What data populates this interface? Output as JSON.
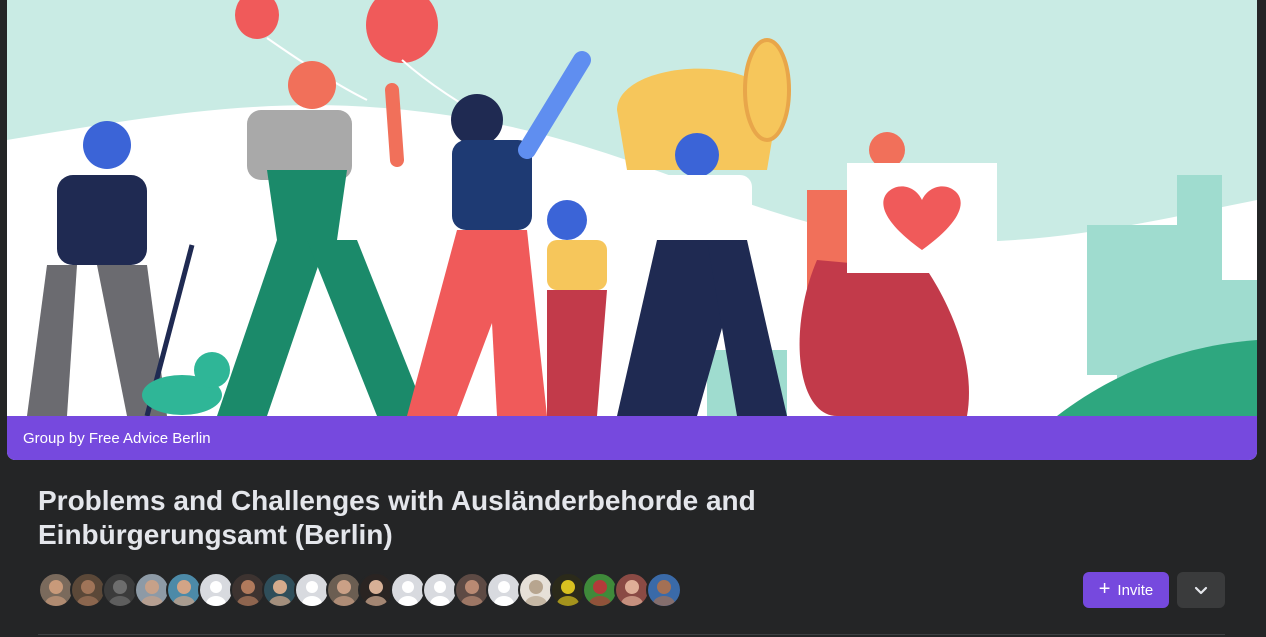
{
  "cover": {
    "group_label": "Group by Free Advice Berlin"
  },
  "group": {
    "title": "Problems and Challenges with Ausländerbehorde and Einbürgerungsamt (Berlin)"
  },
  "members": [
    {
      "bg": "#7a6a5c",
      "face": "#c89a7a"
    },
    {
      "bg": "#5b4838",
      "face": "#a07458"
    },
    {
      "bg": "#3b3b3b",
      "face": "#6d6d6d"
    },
    {
      "bg": "#8d9aa6",
      "face": "#c7a189"
    },
    {
      "bg": "#4c8aa8",
      "face": "#d2a486"
    },
    {
      "bg": "#d8dadf",
      "face": "default"
    },
    {
      "bg": "#3d3330",
      "face": "#b07a5c"
    },
    {
      "bg": "#2f4e5a",
      "face": "#d5ab8c"
    },
    {
      "bg": "#d8dadf",
      "face": "default"
    },
    {
      "bg": "#6b5e52",
      "face": "#caa086"
    },
    {
      "bg": "#2a2422",
      "face": "#d7b096"
    },
    {
      "bg": "#d8dadf",
      "face": "default"
    },
    {
      "bg": "#d8dadf",
      "face": "default"
    },
    {
      "bg": "#5d4a44",
      "face": "#b98a73"
    },
    {
      "bg": "#d8dadf",
      "face": "default"
    },
    {
      "bg": "#e6e0d8",
      "face": "#b7a58f"
    },
    {
      "bg": "#2b2a1a",
      "face": "#d8c020"
    },
    {
      "bg": "#3f8a3a",
      "face": "#b33a3a"
    },
    {
      "bg": "#8a4a44",
      "face": "#dfae97"
    },
    {
      "bg": "#3a6aa8",
      "face": "#a47054"
    }
  ],
  "actions": {
    "invite_label": "Invite"
  },
  "colors": {
    "accent": "#7649de",
    "background": "#242526",
    "title_text": "#e4e6eb"
  }
}
